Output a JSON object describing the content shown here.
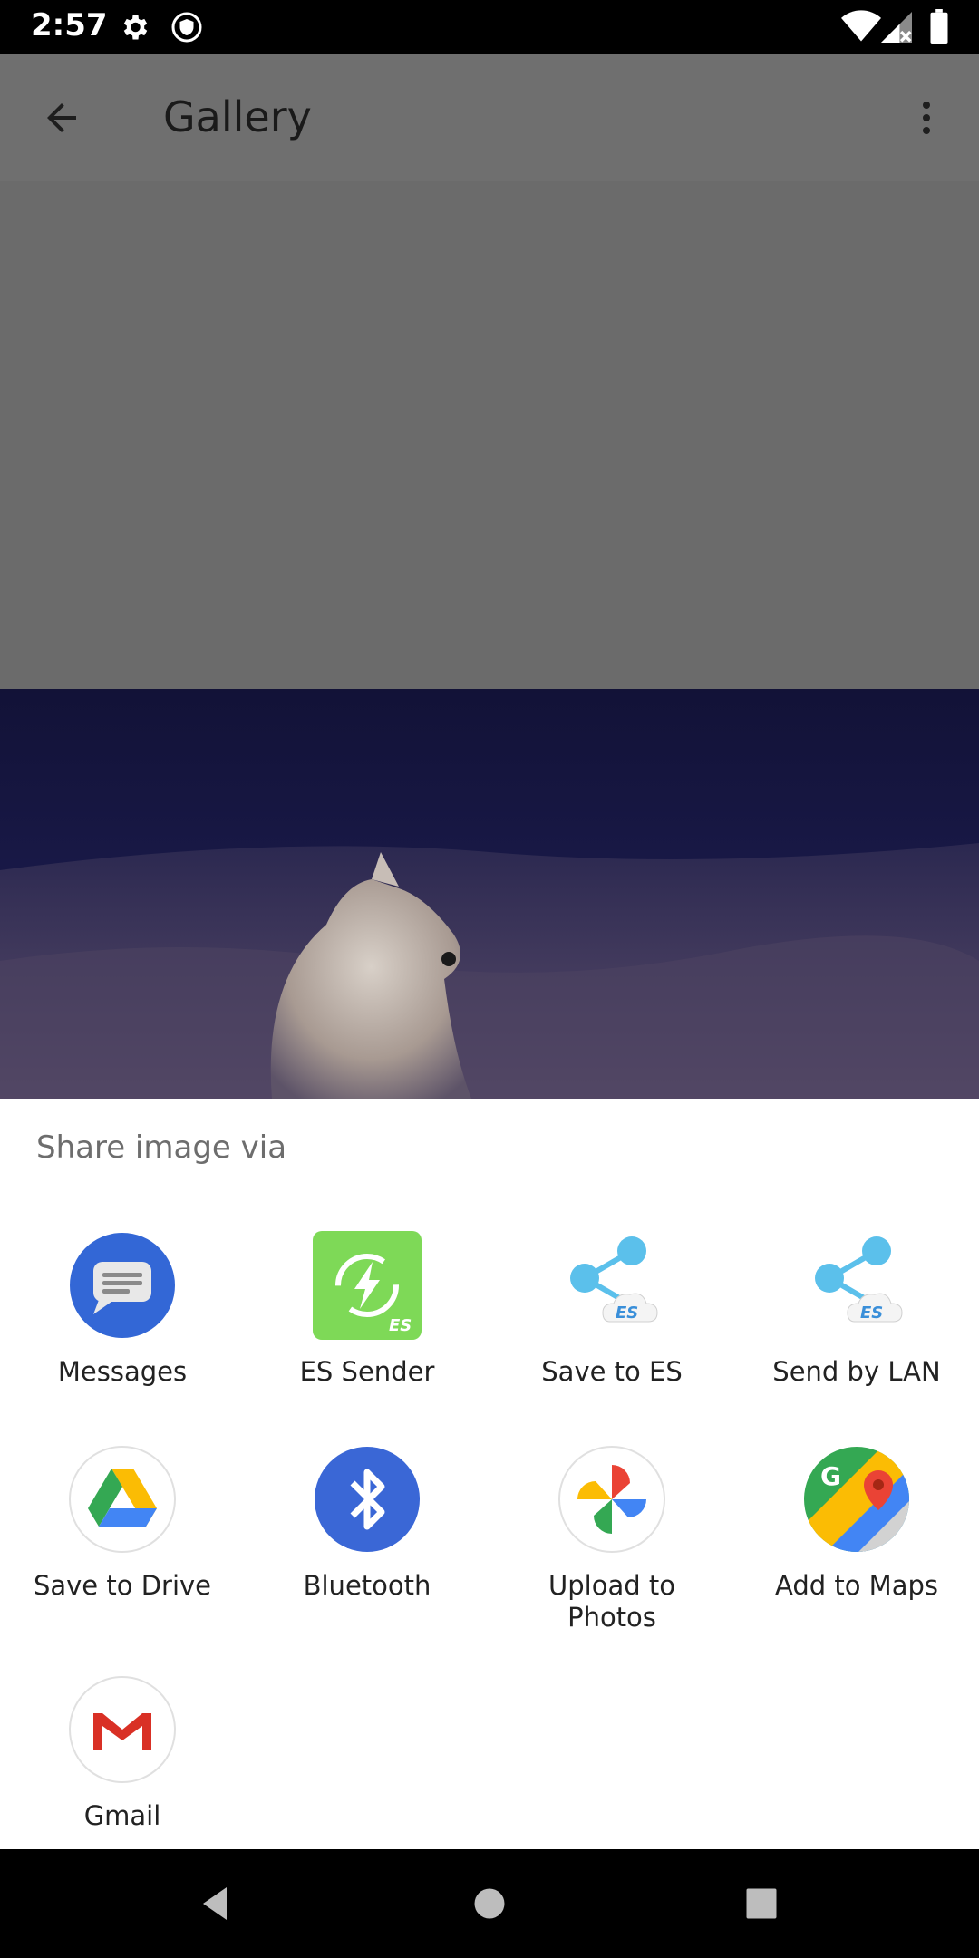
{
  "status_bar": {
    "time": "2:57"
  },
  "app_bar": {
    "title": "Gallery"
  },
  "share_sheet": {
    "title": "Share image via",
    "apps": [
      {
        "label": "Messages",
        "icon": "messages-icon"
      },
      {
        "label": "ES Sender",
        "icon": "es-sender-icon"
      },
      {
        "label": "Save to ES",
        "icon": "es-share-icon"
      },
      {
        "label": "Send by LAN",
        "icon": "es-share-icon"
      },
      {
        "label": "Save to Drive",
        "icon": "drive-icon"
      },
      {
        "label": "Bluetooth",
        "icon": "bluetooth-icon"
      },
      {
        "label": "Upload to\nPhotos",
        "icon": "photos-icon"
      },
      {
        "label": "Add to Maps",
        "icon": "maps-icon"
      },
      {
        "label": "Gmail",
        "icon": "gmail-icon"
      }
    ]
  },
  "colors": {
    "scrim": "#6f6f6f",
    "sheet_bg": "#ffffff",
    "messages_blue": "#3367d6",
    "es_green": "#7ed957",
    "bluetooth_blue": "#3a67d6"
  }
}
